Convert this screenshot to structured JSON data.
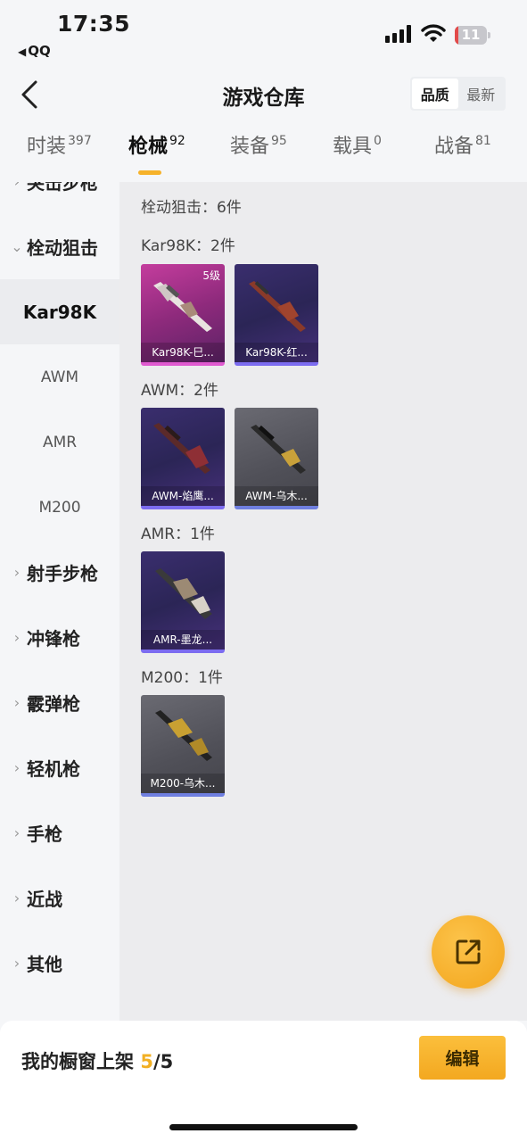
{
  "status_bar": {
    "time": "17:35",
    "back_app": "QQ",
    "battery": "11",
    "battery_level": 0.11,
    "battery_color": "#e24a4a"
  },
  "nav": {
    "back_icon": "chevron-left-icon",
    "title": "游戏仓库",
    "sort_options": [
      "品质",
      "最新"
    ],
    "sort_active": "品质"
  },
  "tabs": [
    {
      "label": "时装",
      "count": "397"
    },
    {
      "label": "枪械",
      "count": "92"
    },
    {
      "label": "装备",
      "count": "95"
    },
    {
      "label": "载具",
      "count": "0"
    },
    {
      "label": "战备",
      "count": "81"
    }
  ],
  "tab_active": "枪械",
  "sidebar": {
    "items": [
      {
        "label": "突击步枪",
        "type": "category",
        "expanded": false
      },
      {
        "label": "栓动狙击",
        "type": "category",
        "expanded": true
      },
      {
        "label": "Kar98K",
        "type": "sub",
        "selected": true
      },
      {
        "label": "AWM",
        "type": "sub"
      },
      {
        "label": "AMR",
        "type": "sub"
      },
      {
        "label": "M200",
        "type": "sub"
      },
      {
        "label": "射手步枪",
        "type": "category",
        "expanded": false
      },
      {
        "label": "冲锋枪",
        "type": "category",
        "expanded": false
      },
      {
        "label": "霰弹枪",
        "type": "category",
        "expanded": false
      },
      {
        "label": "轻机枪",
        "type": "category",
        "expanded": false
      },
      {
        "label": "手枪",
        "type": "category",
        "expanded": false
      },
      {
        "label": "近战",
        "type": "category",
        "expanded": false
      },
      {
        "label": "其他",
        "type": "category",
        "expanded": false
      }
    ]
  },
  "main": {
    "summary": "栓动狙击：6件",
    "groups": [
      {
        "label": "Kar98K：2件",
        "items": [
          {
            "name": "Kar98K-巳...",
            "rarity": "pink",
            "level": "5级"
          },
          {
            "name": "Kar98K-红...",
            "rarity": "purple"
          }
        ]
      },
      {
        "label": "AWM：2件",
        "items": [
          {
            "name": "AWM-焰鹰...",
            "rarity": "purple"
          },
          {
            "name": "AWM-乌木...",
            "rarity": "gray"
          }
        ]
      },
      {
        "label": "AMR：1件",
        "items": [
          {
            "name": "AMR-墨龙...",
            "rarity": "purple"
          }
        ]
      },
      {
        "label": "M200：1件",
        "items": [
          {
            "name": "M200-乌木...",
            "rarity": "gray"
          }
        ]
      }
    ]
  },
  "fab": {
    "icon": "share-external-icon"
  },
  "bottom": {
    "shelf_label": "我的橱窗上架",
    "shelf_current": "5",
    "shelf_total": "/5",
    "edit_label": "编辑"
  },
  "colors": {
    "accent": "#f6b22a",
    "rarity_pink": "#c43d9d",
    "rarity_purple": "#3a2e6e",
    "rarity_gray": "#5a5a62"
  }
}
